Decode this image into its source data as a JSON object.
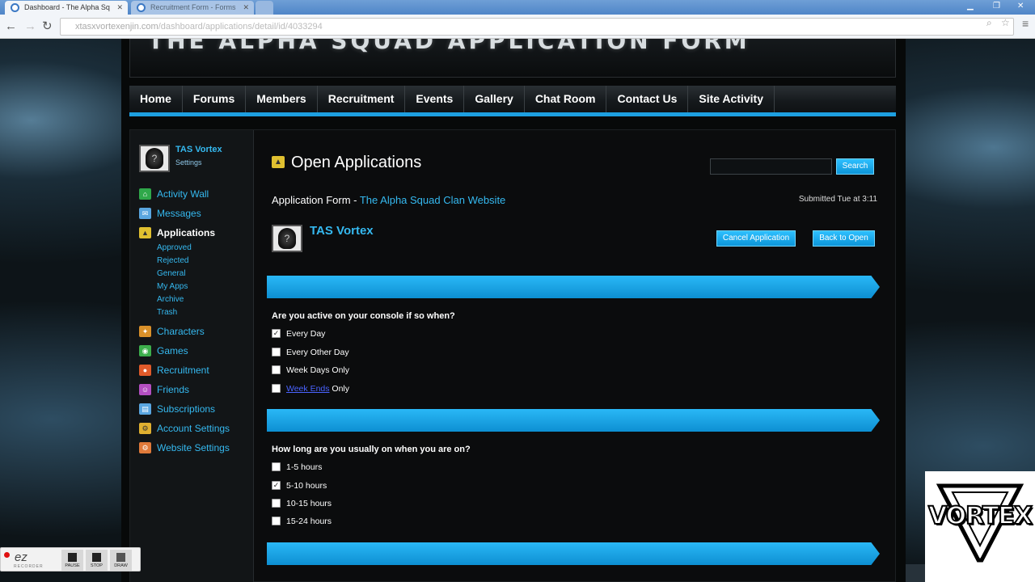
{
  "browser": {
    "tabs": [
      {
        "title": "Dashboard - The Alpha Sq",
        "active": true
      },
      {
        "title": "Recruitment Form - Forms",
        "active": false
      }
    ],
    "url_host": "xtasxvortexenjin.com",
    "url_path": "/dashboard/applications/detail/id/4033294"
  },
  "site": {
    "banner_title": "THE ALPHA SQUAD APPLICATION FORM",
    "nav": [
      "Home",
      "Forums",
      "Members",
      "Recruitment",
      "Events",
      "Gallery",
      "Chat Room",
      "Contact Us",
      "Site Activity"
    ]
  },
  "sidebar": {
    "username": "TAS Vortex",
    "settings_label": "Settings",
    "items": [
      {
        "label": "Activity Wall",
        "icon": "home-icon",
        "color": "#2fa84a"
      },
      {
        "label": "Messages",
        "icon": "messages-icon",
        "color": "#5aa6e0"
      },
      {
        "label": "Applications",
        "icon": "applications-icon",
        "color": "#e0c030",
        "current": true,
        "sub": [
          "Approved",
          "Rejected",
          "General",
          "My Apps",
          "Archive",
          "Trash"
        ]
      },
      {
        "label": "Characters",
        "icon": "characters-icon",
        "color": "#d9902a"
      },
      {
        "label": "Games",
        "icon": "games-icon",
        "color": "#3cae4c"
      },
      {
        "label": "Recruitment",
        "icon": "recruitment-icon",
        "color": "#e05a2a"
      },
      {
        "label": "Friends",
        "icon": "friends-icon",
        "color": "#b44fc2"
      },
      {
        "label": "Subscriptions",
        "icon": "subscriptions-icon",
        "color": "#5aa6e0"
      },
      {
        "label": "Account Settings",
        "icon": "account-settings-icon",
        "color": "#e0b030"
      },
      {
        "label": "Website Settings",
        "icon": "website-settings-icon",
        "color": "#e07a3a"
      }
    ]
  },
  "main": {
    "heading": "Open Applications",
    "search_button": "Search",
    "form_label": "Application Form - ",
    "form_site": "The Alpha Squad Clan Website",
    "submitted": "Submitted Tue at 3:11",
    "applicant": "TAS Vortex",
    "cancel_button": "Cancel Application",
    "back_button": "Back to Open",
    "questions": [
      {
        "text": "Are you active on your console if so when?",
        "options": [
          {
            "label": "Every Day",
            "checked": true
          },
          {
            "label": "Every Other Day",
            "checked": false
          },
          {
            "label": "Week Days Only",
            "checked": false
          },
          {
            "label_link": "Week Ends",
            "label_rest": " Only",
            "checked": false
          }
        ]
      },
      {
        "text": "How long are you usually on when you are on?",
        "options": [
          {
            "label": "1-5 hours",
            "checked": false
          },
          {
            "label": "5-10 hours",
            "checked": true
          },
          {
            "label": "10-15 hours",
            "checked": false
          },
          {
            "label": "15-24 hours",
            "checked": false
          }
        ]
      }
    ]
  },
  "overlays": {
    "recorder_logo": "ez",
    "recorder_sub": "RECORDER",
    "recorder_buttons": [
      "PAUSE",
      "STOP",
      "DRAW"
    ],
    "watermark": "VORTEX"
  },
  "colors": {
    "accent": "#1d9fe0",
    "link": "#35b9f0"
  }
}
